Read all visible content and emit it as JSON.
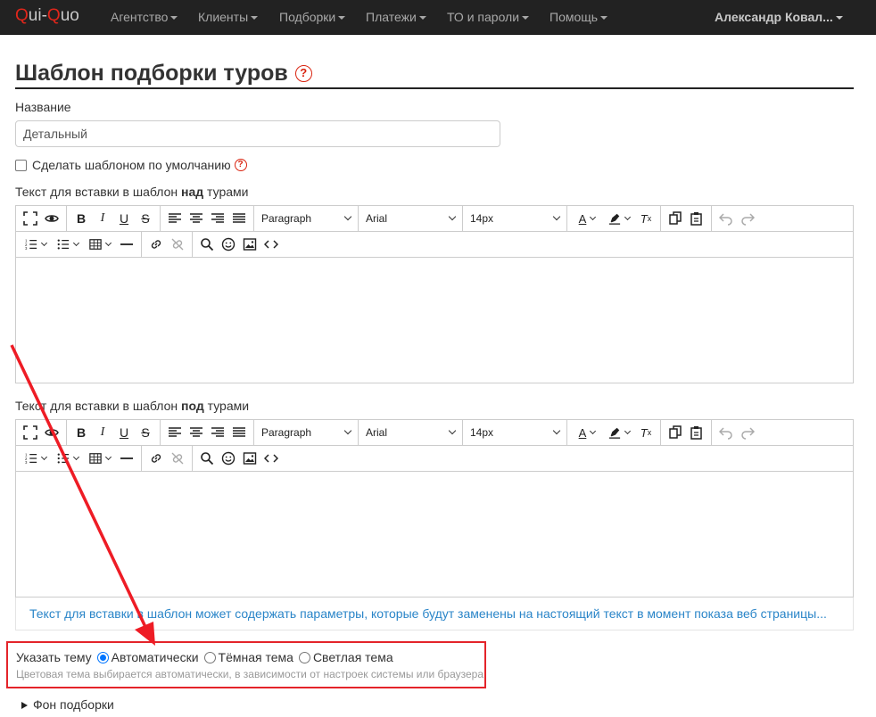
{
  "navbar": {
    "brand_q1": "Q",
    "brand_ui": "ui-",
    "brand_q2": "Q",
    "brand_uo": "uo",
    "items": [
      "Агентство",
      "Клиенты",
      "Подборки",
      "Платежи",
      "ТО и пароли",
      "Помощь"
    ],
    "user": "Александр Ковал..."
  },
  "page": {
    "title": "Шаблон подборки туров",
    "help_glyph": "?"
  },
  "form": {
    "name_label": "Название",
    "name_value": "Детальный",
    "default_checkbox_label": "Сделать шаблоном по умолчанию",
    "above_label_pre": "Текст для вставки в шаблон ",
    "above_label_bold": "над",
    "above_label_post": " турами",
    "below_label_pre": "Текст для вставки в шаблон ",
    "below_label_bold": "под",
    "below_label_post": " турами",
    "hint": "Текст для вставки в шаблон может содержать параметры, которые будут заменены на настоящий текст в момент показа веб страницы...",
    "theme_label": "Указать тему",
    "theme_options": [
      "Автоматически",
      "Тёмная тема",
      "Светлая тема"
    ],
    "theme_selected": "Автоматически",
    "theme_hint": "Цветовая тема выбирается автоматически, в зависимости от настроек системы или браузера",
    "background_section": "Фон подборки"
  },
  "editor": {
    "block_format": "Paragraph",
    "font_family": "Arial",
    "font_size": "14px",
    "icons": {
      "fullscreen": "fullscreen-icon",
      "preview": "preview-icon",
      "bold": "bold-icon",
      "italic": "italic-icon",
      "underline": "underline-icon",
      "strikethrough": "strikethrough-icon",
      "align_left": "align-left-icon",
      "align_center": "align-center-icon",
      "align_right": "align-right-icon",
      "align_justify": "align-justify-icon",
      "text_color": "text-color-icon",
      "highlight": "highlight-icon",
      "clear_format": "clear-format-icon",
      "copy": "copy-icon",
      "paste": "paste-icon",
      "undo": "undo-icon",
      "redo": "redo-icon",
      "numbered_list": "numbered-list-icon",
      "bullet_list": "bullet-list-icon",
      "table": "table-icon",
      "hr": "horizontal-rule-icon",
      "link": "link-icon",
      "unlink": "unlink-icon",
      "search": "search-icon",
      "emoji": "emoji-icon",
      "image": "image-icon",
      "code": "code-icon"
    }
  },
  "colors": {
    "navbar_bg": "#222222",
    "accent_red": "#e4242a",
    "link_blue": "#2a85c8",
    "radio_blue": "#0075ff"
  }
}
